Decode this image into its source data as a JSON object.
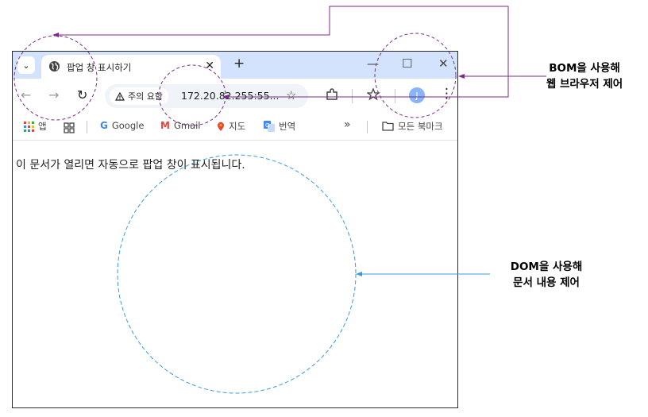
{
  "browser": {
    "tab_list_glyph": "⌄",
    "tab": {
      "title": "팝업 창 표시하기",
      "close": "✕"
    },
    "new_tab": "+",
    "window_controls": {
      "minimize": "—",
      "maximize": "☐",
      "close": "✕"
    },
    "toolbar": {
      "back": "←",
      "forward": "→",
      "reload": "↻",
      "security_label": "주의 요함",
      "url": "172.20.82.255:55...",
      "star": "☆",
      "profile_initial": "J",
      "menu": "⋮"
    },
    "bookmarks": {
      "apps": "앱",
      "items": [
        "Google",
        "Gmail",
        "지도",
        "번역"
      ],
      "more": "»",
      "all_bookmarks": "모든 북마크"
    },
    "page_text": "이 문서가 열리면 자동으로 팝업 창이 표시됩니다."
  },
  "annotations": {
    "bom_line1": "BOM을 사용해",
    "bom_line2": "웹 브라우저 제어",
    "dom_line1": "DOM을 사용해",
    "dom_line2": "문서 내용 제어"
  },
  "colors": {
    "tabstrip": "#d3e3fd",
    "bom_annotation": "#7b2a8a",
    "dom_annotation": "#3b9bd9"
  }
}
